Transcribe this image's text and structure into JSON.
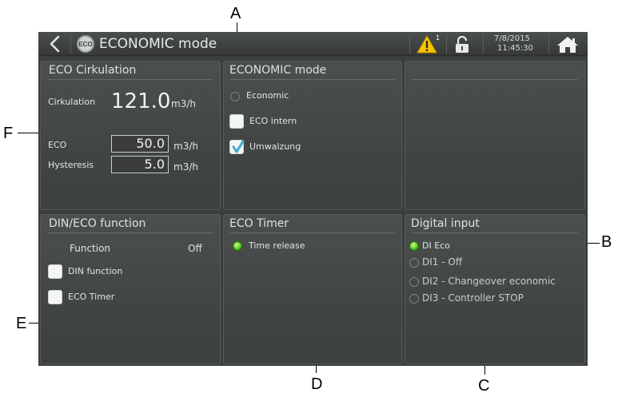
{
  "callouts": {
    "a": "A",
    "b": "B",
    "c": "C",
    "d": "D",
    "e": "E",
    "f": "F"
  },
  "titlebar": {
    "title": "ECONOMIC mode",
    "logo_text": "ECO",
    "alarm_count": "1",
    "date": "7/8/2015",
    "time": "11:45:30",
    "icons": [
      "back-arrow-icon",
      "eco-logo-icon",
      "warning-icon",
      "unlock-icon",
      "home-icon"
    ],
    "warning_color": "#f5c400"
  },
  "eco_circulation": {
    "title": "ECO Cirkulation",
    "cirkulation_label": "Cirkulation",
    "cirkulation_value": "121.0",
    "cirkulation_unit": "m3/h",
    "eco_label": "ECO",
    "eco_value": "50.0",
    "eco_unit": "m3/h",
    "hysteresis_label": "Hysteresis",
    "hysteresis_value": "5.0",
    "hysteresis_unit": "m3/h"
  },
  "economic_mode": {
    "title": "ECONOMIC mode",
    "options": [
      {
        "label": "Economic",
        "type": "radio",
        "checked": false
      },
      {
        "label": "ECO intern",
        "type": "checkbox",
        "checked": false
      },
      {
        "label": "Umwalzung",
        "type": "checkbox",
        "checked": true
      }
    ]
  },
  "din_eco": {
    "title": "DIN/ECO function",
    "function_label": "Function",
    "function_value": "Off",
    "din_function_label": "DIN function",
    "eco_timer_label": "ECO Timer"
  },
  "eco_timer": {
    "title": "ECO Timer",
    "time_release_label": "Time release",
    "time_release_active": true
  },
  "digital_input": {
    "title": "Digital input",
    "items": [
      {
        "label": "DI Eco",
        "active": true
      },
      {
        "label": "DI1 - Off",
        "active": false
      },
      {
        "label": "DI2 - Changeover economic",
        "active": false
      },
      {
        "label": "DI3 - Controller STOP",
        "active": false
      }
    ]
  }
}
